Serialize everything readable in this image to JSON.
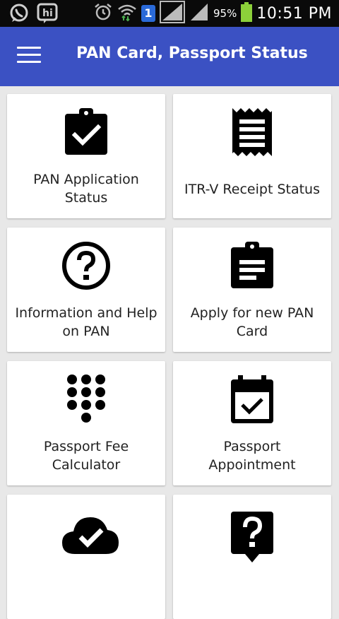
{
  "status_bar": {
    "time": "10:51 PM",
    "battery_percent": "95%",
    "notification_badge": "1",
    "left_icons": [
      "whatsapp-icon",
      "hike-icon"
    ],
    "right_icons": [
      "alarm-icon",
      "wifi-icon",
      "sim-icon",
      "signal-icon",
      "signal-icon",
      "battery-icon"
    ]
  },
  "app_bar": {
    "title": "PAN Card, Passport Status",
    "menu_icon": "hamburger-menu-icon",
    "color": "#3b51c3"
  },
  "cards": [
    {
      "label": "PAN Application Status",
      "icon": "clipboard-check-icon"
    },
    {
      "label": "ITR-V Receipt Status",
      "icon": "receipt-icon"
    },
    {
      "label": "Information and Help on PAN",
      "icon": "help-circle-icon"
    },
    {
      "label": "Apply for new PAN Card",
      "icon": "clipboard-text-icon"
    },
    {
      "label": "Passport Fee Calculator",
      "icon": "dialpad-icon"
    },
    {
      "label": "Passport Appointment",
      "icon": "calendar-check-icon"
    },
    {
      "label": "",
      "icon": "cloud-check-icon"
    },
    {
      "label": "",
      "icon": "help-bubble-icon"
    }
  ]
}
